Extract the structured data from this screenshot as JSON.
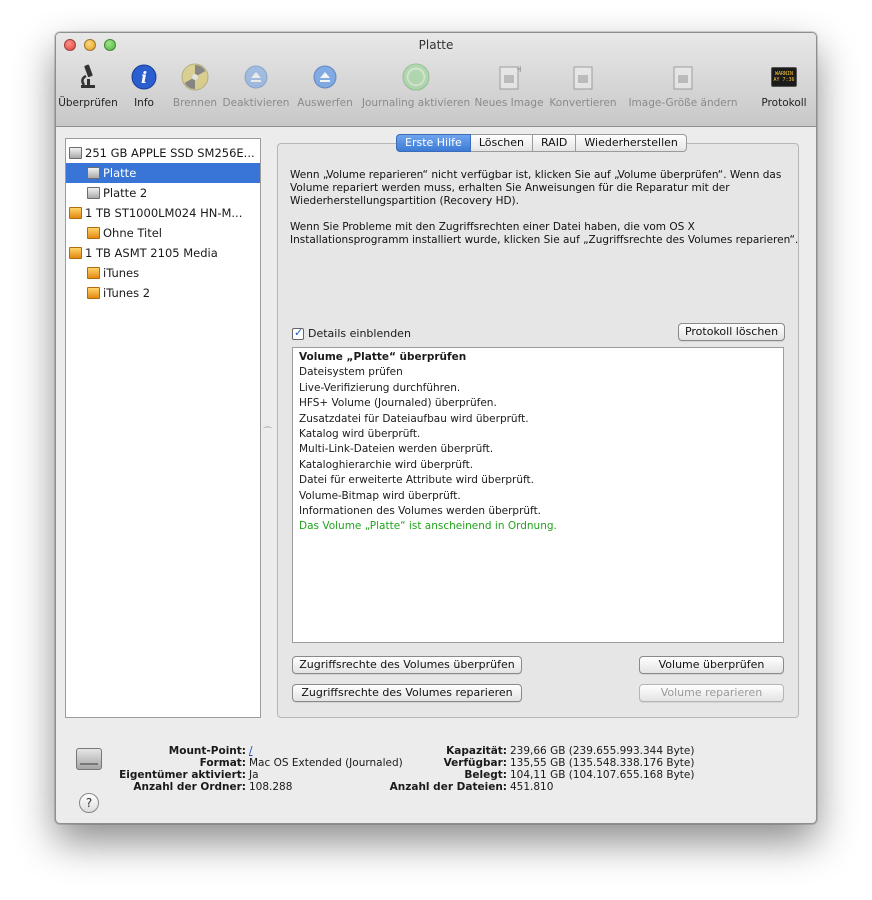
{
  "window": {
    "title": "Platte"
  },
  "toolbar": {
    "items": [
      {
        "label": "Überprüfen",
        "icon": "microscope-icon",
        "enabled": true
      },
      {
        "label": "Info",
        "icon": "info-icon",
        "enabled": true
      },
      {
        "label": "Brennen",
        "icon": "burn-icon",
        "enabled": false
      },
      {
        "label": "Deaktivieren",
        "icon": "eject-icon",
        "enabled": false
      },
      {
        "label": "Auswerfen",
        "icon": "eject-icon",
        "enabled": false
      },
      {
        "label": "Journaling aktivieren",
        "icon": "journaling-icon",
        "enabled": false
      },
      {
        "label": "Neues Image",
        "icon": "new-image-icon",
        "enabled": false
      },
      {
        "label": "Konvertieren",
        "icon": "convert-icon",
        "enabled": false
      },
      {
        "label": "Image-Größe ändern",
        "icon": "resize-image-icon",
        "enabled": false
      },
      {
        "label": "Protokoll",
        "icon": "console-log-icon",
        "enabled": true,
        "icon_text": "WARNIN\nAY 7:36"
      }
    ]
  },
  "sidebar": {
    "items": [
      {
        "label": "251 GB APPLE SSD SM256E...",
        "kind": "disk-gray",
        "selected": false
      },
      {
        "label": "Platte",
        "kind": "disk-gray",
        "selected": true
      },
      {
        "label": "Platte 2",
        "kind": "disk-gray",
        "selected": false
      },
      {
        "label": "1 TB ST1000LM024 HN-M...",
        "kind": "disk-orange",
        "selected": false
      },
      {
        "label": "Ohne Titel",
        "kind": "disk-orange",
        "selected": false
      },
      {
        "label": "1 TB ASMT 2105 Media",
        "kind": "disk-orange",
        "selected": false
      },
      {
        "label": "iTunes",
        "kind": "disk-orange",
        "selected": false
      },
      {
        "label": "iTunes 2",
        "kind": "disk-orange",
        "selected": false
      }
    ]
  },
  "tabs": [
    {
      "label": "Erste Hilfe",
      "active": true
    },
    {
      "label": "Löschen",
      "active": false
    },
    {
      "label": "RAID",
      "active": false
    },
    {
      "label": "Wiederherstellen",
      "active": false
    }
  ],
  "first_aid": {
    "paragraph1": "Wenn „Volume reparieren“ nicht verfügbar ist, klicken Sie auf „Volume überprüfen“. Wenn das Volume repariert werden muss, erhalten Sie Anweisungen für die Reparatur mit der Wiederherstellungspartition (Recovery HD).",
    "paragraph2": "Wenn Sie Probleme mit den Zugriffsrechten einer Datei haben, die vom OS X Installationsprogramm installiert wurde, klicken Sie auf „Zugriffsrechte des Volumes reparieren“.",
    "show_details_label": "Details einblenden",
    "show_details_checked": true,
    "clear_log_label": "Protokoll löschen",
    "log_lines": [
      "Volume „Platte“ überprüfen",
      "Dateisystem prüfen",
      "Live-Verifizierung durchführen.",
      "HFS+ Volume (Journaled) überprüfen.",
      "Zusatzdatei für Dateiaufbau wird überprüft.",
      "Katalog wird überprüft.",
      "Multi-Link-Dateien werden überprüft.",
      "Kataloghierarchie wird überprüft.",
      "Datei für erweiterte Attribute wird überprüft.",
      "Volume-Bitmap wird überprüft.",
      "Informationen des Volumes werden überprüft.",
      "Das Volume „Platte“ ist anscheinend in Ordnung."
    ],
    "verify_permissions_label": "Zugriffsrechte des Volumes überprüfen",
    "repair_permissions_label": "Zugriffsrechte des Volumes reparieren",
    "verify_volume_label": "Volume überprüfen",
    "repair_volume_label": "Volume reparieren",
    "success_color": "#22a31e"
  },
  "volume_info": {
    "mount_point_key": "Mount-Point:",
    "mount_point_value": "/",
    "format_key": "Format:",
    "format_value": "Mac OS Extended (Journaled)",
    "owners_key": "Eigentümer aktiviert:",
    "owners_value": "Ja",
    "folders_key": "Anzahl der Ordner:",
    "folders_value": "108.288",
    "capacity_key": "Kapazität:",
    "capacity_value": "239,66 GB (239.655.993.344 Byte)",
    "available_key": "Verfügbar:",
    "available_value": "135,55 GB (135.548.338.176 Byte)",
    "used_key": "Belegt:",
    "used_value": "104,11 GB (104.107.655.168 Byte)",
    "files_key": "Anzahl der Dateien:",
    "files_value": "451.810"
  },
  "help_label": "?"
}
